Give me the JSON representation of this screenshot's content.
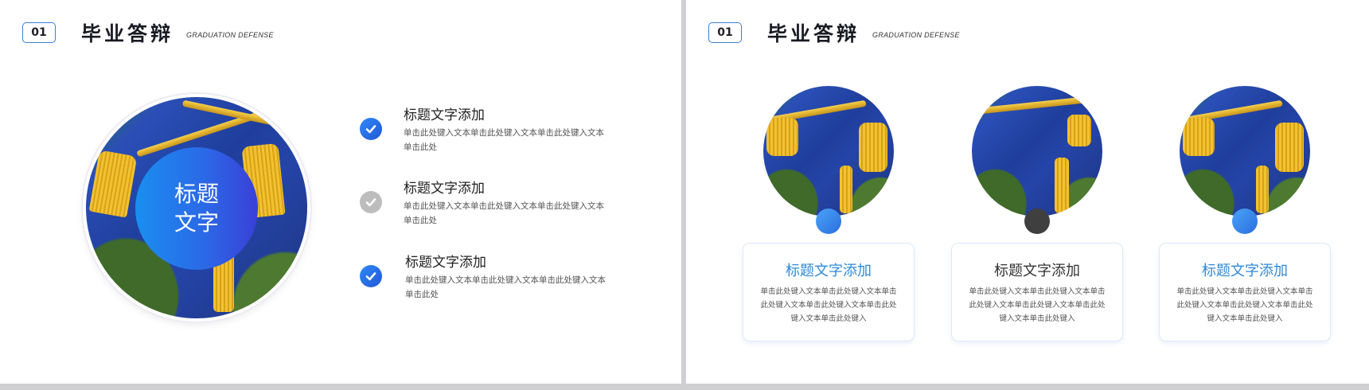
{
  "header": {
    "number": "01",
    "title": "毕业答辩",
    "subtitle": "GRADUATION DEFENSE"
  },
  "left_slide": {
    "badge_line1": "标题",
    "badge_line2": "文字",
    "items": [
      {
        "title": "标题文字添加",
        "text": "单击此处键入文本单击此处键入文本单击此处键入文本单击此处",
        "check": "blue"
      },
      {
        "title": "标题文字添加",
        "text": "单击此处键入文本单击此处键入文本单击此处键入文本单击此处",
        "check": "grey"
      },
      {
        "title": "标题文字添加",
        "text": "单击此处键入文本单击此处键入文本单击此处键入文本单击此处",
        "check": "blue"
      }
    ]
  },
  "right_slide": {
    "cards": [
      {
        "title": "标题文字添加",
        "text": "单击此处键入文本单击此处键入文本单击此处键入文本单击此处键入文本单击此处键入文本单击此处键入",
        "accent": "blue"
      },
      {
        "title": "标题文字添加",
        "text": "单击此处键入文本单击此处键入文本单击此处键入文本单击此处键入文本单击此处键入文本单击此处键入",
        "accent": "dark"
      },
      {
        "title": "标题文字添加",
        "text": "单击此处键入文本单击此处键入文本单击此处键入文本单击此处键入文本单击此处键入文本单击此处键入",
        "accent": "blue"
      }
    ]
  },
  "colors": {
    "accent_blue": "#2f8ad8",
    "badge_gradient_start": "#1a8ef0",
    "badge_gradient_end": "#3a3fd8",
    "check_grey": "#bdbdbd",
    "dot_dark": "#3f3f3f"
  },
  "icons": [
    "check-icon",
    "graduation-cap-photo"
  ]
}
